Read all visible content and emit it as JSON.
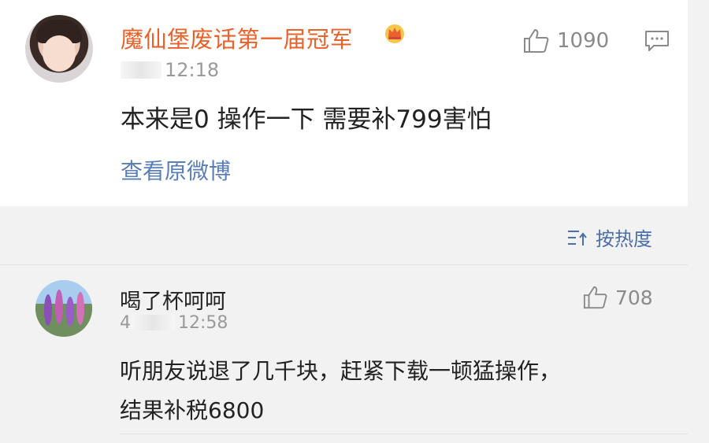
{
  "top_comment": {
    "username": "魔仙堡废话第一届冠军",
    "time": "12:18",
    "like_count": "1090",
    "content": "本来是0 操作一下 需要补799害怕",
    "view_original": "查看原微博",
    "username_color": "#e8622a"
  },
  "sort": {
    "label": "按热度"
  },
  "reply": {
    "username": "喝了杯呵呵",
    "time": "12:58",
    "time_prefix": "4",
    "like_count": "708",
    "content_line1": "听朋友说退了几千块，赶紧下载一顿猛操作，",
    "content_line2": "结果补税6800"
  },
  "icons": {
    "like": "thumbs-up-icon",
    "comment": "comment-icon",
    "crown": "crown-badge-icon",
    "sort": "sort-icon"
  },
  "colors": {
    "link": "#5a7eb8",
    "text": "#222222",
    "muted": "#9a9a9a",
    "background": "#f2f2f2"
  }
}
